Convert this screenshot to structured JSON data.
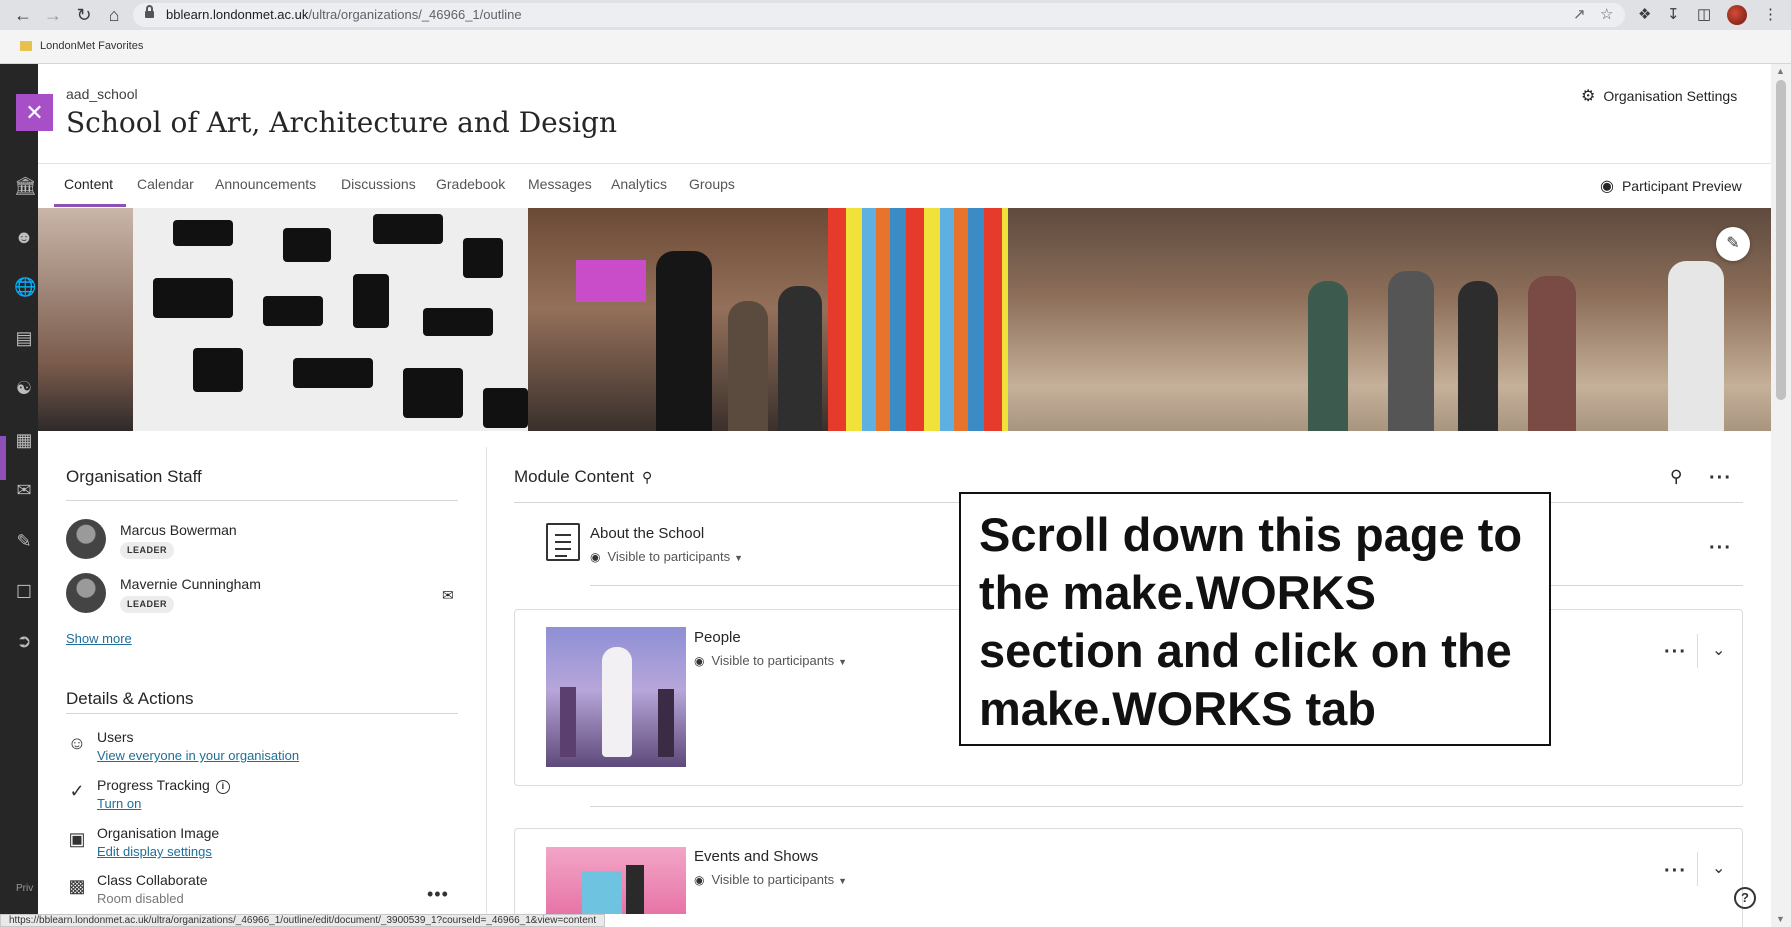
{
  "browser": {
    "url_host": "bblearn.londonmet.ac.uk",
    "url_path": "/ultra/organizations/_46966_1/outline",
    "bookmark": "LondonMet Favorites",
    "status_url": "https://bblearn.londonmet.ac.uk/ultra/organizations/_46966_1/outline/edit/document/_3900539_1?courseId=_46966_1&view=content"
  },
  "header": {
    "org_id": "aad_school",
    "title": "School of Art, Architecture and Design",
    "settings_label": "Organisation Settings",
    "preview_label": "Participant Preview"
  },
  "tabs": [
    "Content",
    "Calendar",
    "Announcements",
    "Discussions",
    "Gradebook",
    "Messages",
    "Analytics",
    "Groups"
  ],
  "staff": {
    "heading": "Organisation Staff",
    "members": [
      {
        "name": "Marcus Bowerman",
        "role": "LEADER"
      },
      {
        "name": "Mavernie Cunningham",
        "role": "LEADER"
      }
    ],
    "show_more": "Show more"
  },
  "details": {
    "heading": "Details & Actions",
    "users": {
      "title": "Users",
      "link": "View everyone in your organisation"
    },
    "progress": {
      "title": "Progress Tracking",
      "link": "Turn on"
    },
    "image": {
      "title": "Organisation Image",
      "link": "Edit display settings"
    },
    "collab": {
      "title": "Class Collaborate",
      "sub": "Room disabled"
    }
  },
  "module": {
    "heading": "Module Content",
    "items": [
      {
        "title": "About the School",
        "visibility": "Visible to participants"
      },
      {
        "title": "People",
        "visibility": "Visible to participants"
      },
      {
        "title": "Events and Shows",
        "visibility": "Visible to participants"
      }
    ]
  },
  "overlay_text": "Scroll down this page to the make.WORKS section and click on the make.WORKS tab",
  "sidebar_footer": "Priv",
  "icons": [
    "back-icon",
    "forward-icon",
    "reload-icon",
    "home-icon",
    "lock-icon",
    "share-icon",
    "star-icon",
    "extensions-icon",
    "download-icon",
    "sidepanel-icon",
    "menu-icon",
    "institution-icon",
    "profile-icon",
    "globe-icon",
    "courses-icon",
    "organizations-icon",
    "calendar-icon",
    "messages-icon",
    "grades-icon",
    "tools-icon",
    "logout-icon",
    "gear-icon",
    "eye-icon",
    "pencil-icon",
    "mail-icon",
    "users-icon",
    "progress-icon",
    "image-icon",
    "collaborate-icon",
    "search-icon",
    "help-icon"
  ],
  "colors": {
    "accent": "#8e4fb6",
    "close": "#a74fc7",
    "link": "#1f6e98"
  }
}
